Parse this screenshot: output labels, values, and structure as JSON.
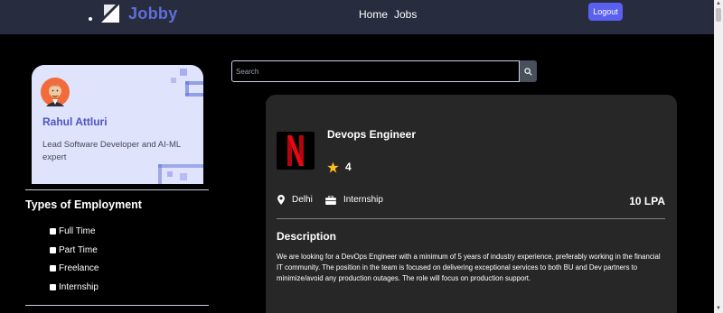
{
  "header": {
    "logo_text": "Jobby",
    "nav": [
      "Home",
      "Jobs"
    ],
    "logout_label": "Logout"
  },
  "profile": {
    "name": "Rahul Attluri",
    "bio": "Lead Software Developer and AI-ML expert"
  },
  "filters": {
    "heading": "Types of Employment",
    "options": [
      "Full Time",
      "Part Time",
      "Freelance",
      "Internship"
    ]
  },
  "search": {
    "placeholder": "Search",
    "value": ""
  },
  "job": {
    "title": "Devops Engineer",
    "rating": "4",
    "location": "Delhi",
    "employment_type": "Internship",
    "package": "10 LPA",
    "description_heading": "Description",
    "description": "We are looking for a DevOps Engineer with a minimum of 5 years of industry experience, preferably working in the financial IT community. The position in the team is focused on delivering exceptional services to both BU and Dev partners to minimize/avoid any production outages. The role will focus on production support."
  },
  "colors": {
    "header_bg": "#272c3f",
    "logo_accent": "#5f6fd8",
    "logout_bg": "#5a60f0",
    "profile_bg": "#dfe3fb",
    "profile_name": "#4f54c4",
    "card_bg": "#272727",
    "star": "#fbbf24",
    "netflix_red": "#e50914"
  },
  "icons": {
    "search": "search-icon",
    "star": "star-icon",
    "location": "location-icon",
    "briefcase": "briefcase-icon"
  }
}
